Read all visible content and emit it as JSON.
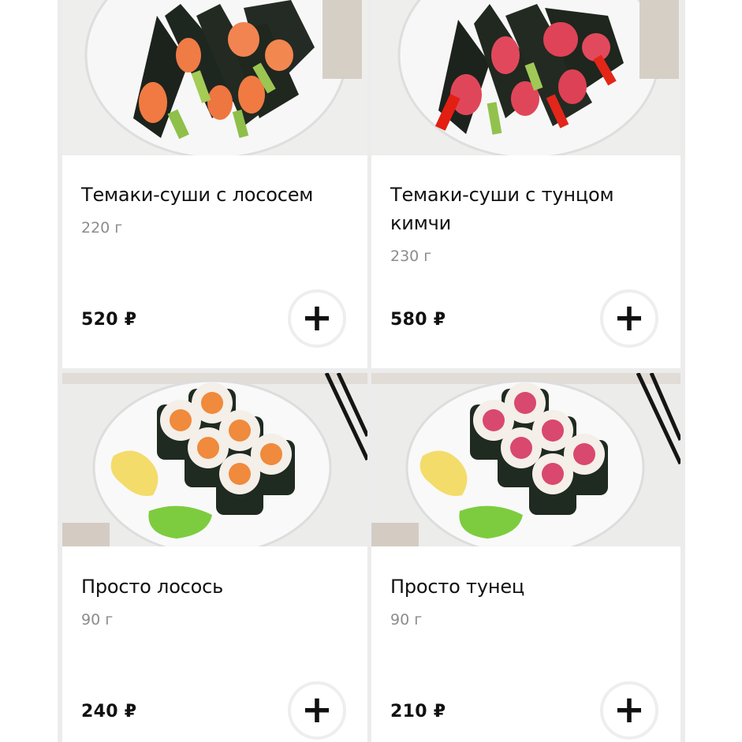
{
  "products": [
    {
      "name": "Темаки-суши с лососем",
      "weight": "220 г",
      "price": "520 ₽",
      "add_label": "+"
    },
    {
      "name": "Темаки-суши с тунцом кимчи",
      "weight": "230 г",
      "price": "580 ₽",
      "add_label": "+"
    },
    {
      "name": "Просто лосось",
      "weight": "90 г",
      "price": "240 ₽",
      "add_label": "+"
    },
    {
      "name": "Просто тунец",
      "weight": "90 г",
      "price": "210 ₽",
      "add_label": "+"
    }
  ],
  "colors": {
    "background": "#ececec",
    "card": "#ffffff",
    "text": "#111111",
    "muted": "#8c8c8c"
  }
}
